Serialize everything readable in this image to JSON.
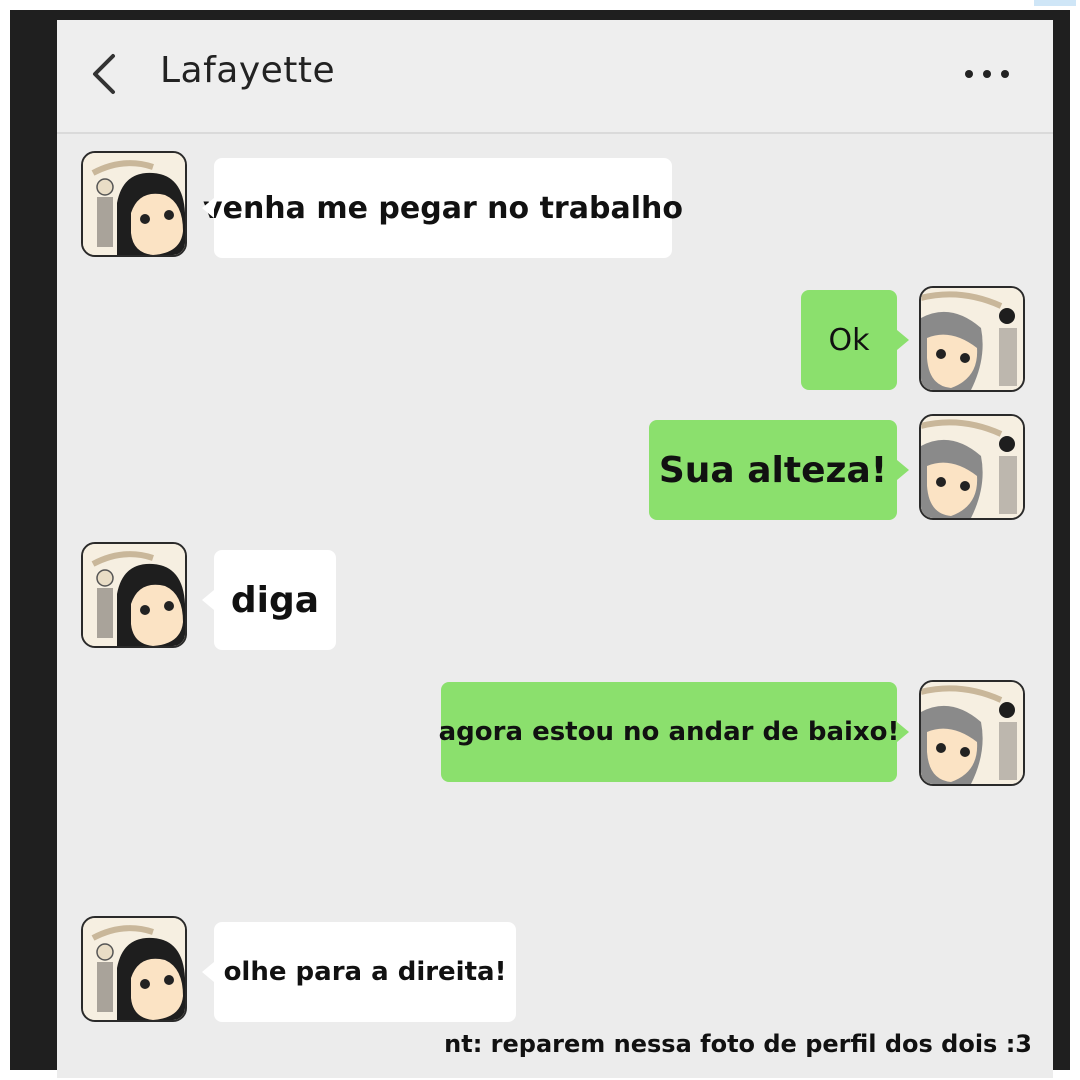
{
  "header": {
    "title": "Lafayette",
    "back_icon": "chevron-left-icon",
    "menu_icon": "more-horizontal-icon"
  },
  "messages": [
    {
      "side": "in",
      "text": "venha me pegar no trabalho"
    },
    {
      "side": "out",
      "text": "Ok"
    },
    {
      "side": "out",
      "text": "Sua alteza!"
    },
    {
      "side": "in",
      "text": "diga"
    },
    {
      "side": "out",
      "text": "agora estou no andar de baixo!"
    },
    {
      "side": "in",
      "text": "olhe para a direita!"
    }
  ],
  "note": "nt: reparem nessa foto de perfil dos dois :3",
  "colors": {
    "outgoing_bubble": "#8be06d",
    "incoming_bubble": "#ffffff",
    "background": "#ececec"
  }
}
